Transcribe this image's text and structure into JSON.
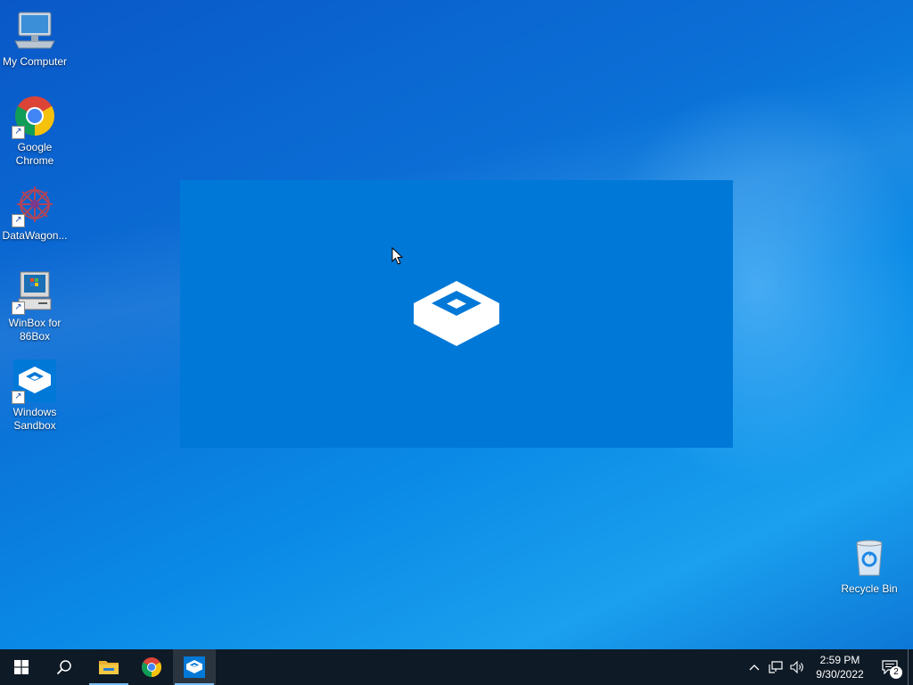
{
  "desktop": {
    "icons": [
      {
        "label": "My Computer",
        "icon": "computer-icon"
      },
      {
        "label": "Google Chrome",
        "icon": "chrome-icon"
      },
      {
        "label": "DataWagon...",
        "icon": "datawagon-icon"
      },
      {
        "label": "WinBox for 86Box",
        "icon": "winbox-icon"
      },
      {
        "label": "Windows Sandbox",
        "icon": "windows-sandbox-icon"
      },
      {
        "label": "Recycle Bin",
        "icon": "recycle-bin-icon"
      }
    ]
  },
  "sandbox_splash": {
    "icon": "windows-sandbox-logo-icon",
    "background": "#0078d7"
  },
  "taskbar": {
    "buttons": [
      {
        "name": "start",
        "icon": "windows-logo-icon"
      },
      {
        "name": "search",
        "icon": "search-icon"
      },
      {
        "name": "file-explorer",
        "icon": "folder-icon"
      },
      {
        "name": "chrome",
        "icon": "chrome-icon"
      },
      {
        "name": "windows-sandbox",
        "icon": "windows-sandbox-icon",
        "active": true
      }
    ],
    "tray": {
      "time": "2:59 PM",
      "date": "9/30/2022",
      "notification_count": "2"
    }
  },
  "colors": {
    "taskbar": "#0e1a26",
    "accent": "#0078d7",
    "running_indicator": "#76b9ed"
  }
}
